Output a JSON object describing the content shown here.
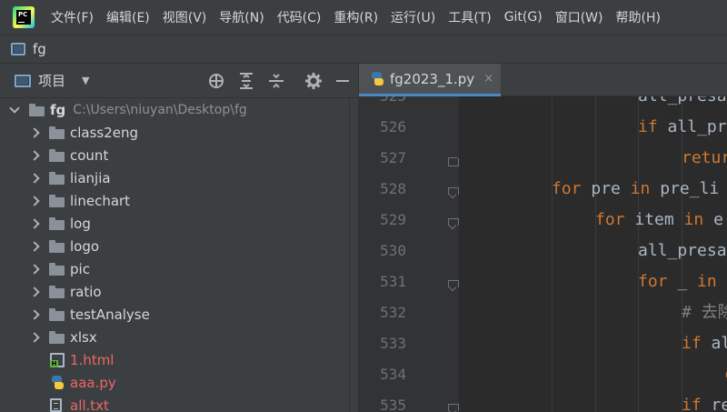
{
  "menubar": {
    "logo_text": "PC",
    "items": [
      "文件(F)",
      "编辑(E)",
      "视图(V)",
      "导航(N)",
      "代码(C)",
      "重构(R)",
      "运行(U)",
      "工具(T)",
      "Git(G)",
      "窗口(W)",
      "帮助(H)"
    ]
  },
  "titlebar": {
    "project_name": "fg"
  },
  "project_panel": {
    "title": "项目",
    "tools": [
      "crosshair-icon",
      "expand-all-icon",
      "collapse-all-icon",
      "gear-icon",
      "minimize-icon"
    ],
    "root": {
      "name": "fg",
      "path": "C:\\Users\\niuyan\\Desktop\\fg"
    },
    "folders": [
      "class2eng",
      "count",
      "lianjia",
      "linechart",
      "log",
      "logo",
      "pic",
      "ratio",
      "testAnalyse",
      "xlsx"
    ],
    "files": [
      {
        "name": "1.html",
        "type": "html"
      },
      {
        "name": "aaa.py",
        "type": "python"
      },
      {
        "name": "all.txt",
        "type": "text"
      }
    ]
  },
  "editor": {
    "tab": {
      "label": "fg2023_1.py",
      "close": "×"
    },
    "lines": [
      {
        "no": "525",
        "text": "all_presa",
        "indent": 4,
        "kw": ""
      },
      {
        "no": "526",
        "text": " all_pr",
        "indent": 4,
        "kw": "if"
      },
      {
        "no": "527",
        "text": "retur",
        "indent": 5,
        "kw": "",
        "kwcolor": true
      },
      {
        "no": "528",
        "text": " pre ",
        "indent": 0,
        "kw": "for",
        "kw2": "in",
        "tail": " pre_li"
      },
      {
        "no": "529",
        "text": " item ",
        "indent": 2,
        "kw": "for",
        "kw2": "in",
        "tail": " e"
      },
      {
        "no": "530",
        "text": "all_presa",
        "indent": 4,
        "kw": ""
      },
      {
        "no": "531",
        "text": " _ ",
        "indent": 4,
        "kw": "for",
        "kw2": "in",
        "tail": ""
      },
      {
        "no": "532",
        "text": "# 去除",
        "indent": 5,
        "kw": "",
        "comment": true
      },
      {
        "no": "533",
        "text": " al",
        "indent": 5,
        "kw": "if"
      },
      {
        "no": "534",
        "text": "c",
        "indent": 6,
        "kw": "",
        "kwcolor": true
      },
      {
        "no": "535",
        "text": " re",
        "indent": 5,
        "kw": "if"
      }
    ]
  },
  "colors": {
    "background": "#2b2b2b",
    "panel": "#3c3f41",
    "keyword": "#cc7832",
    "text": "#a9b7c6",
    "error_file": "#ed6666",
    "accent": "#4a88c7"
  }
}
